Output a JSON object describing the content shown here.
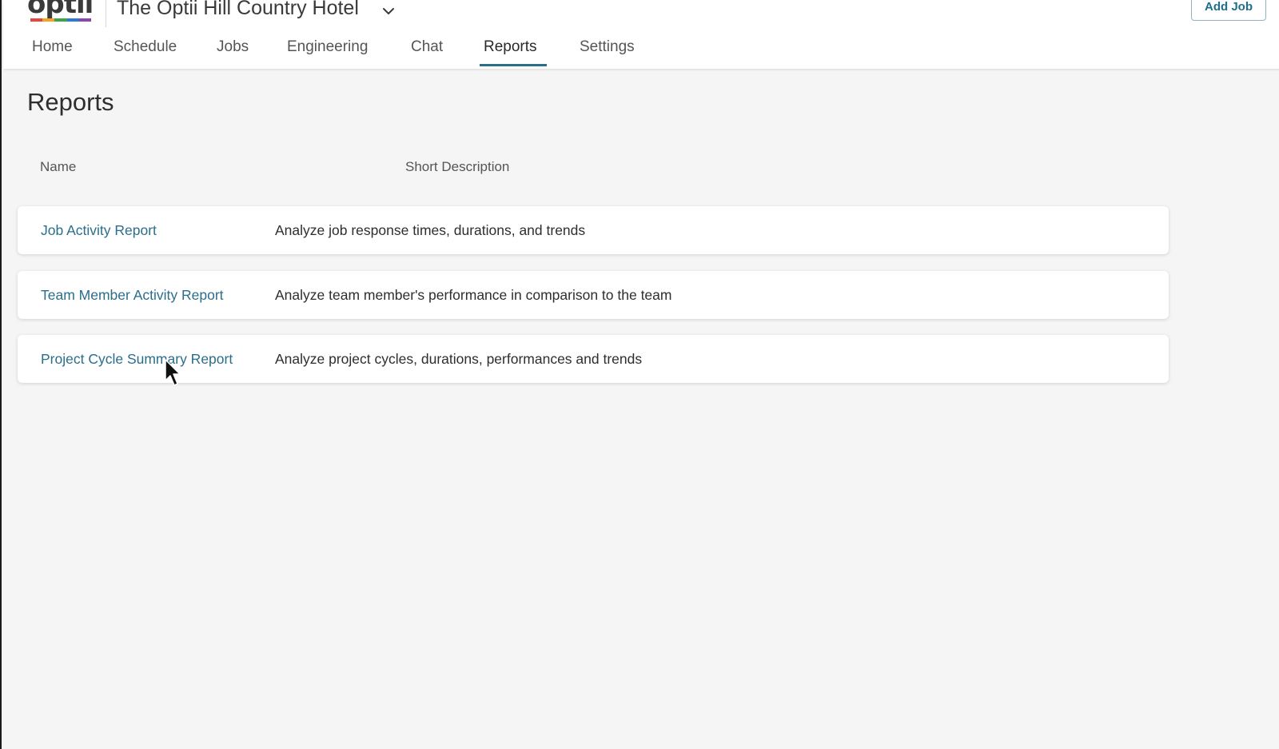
{
  "app": {
    "logo_text": "optii",
    "hotel_title": "The Optii Hill Country Hotel",
    "add_job_label": "Add Job"
  },
  "nav": {
    "tabs": [
      {
        "label": "Home",
        "active": false
      },
      {
        "label": "Schedule",
        "active": false
      },
      {
        "label": "Jobs",
        "active": false
      },
      {
        "label": "Engineering",
        "active": false
      },
      {
        "label": "Chat",
        "active": false
      },
      {
        "label": "Reports",
        "active": true
      },
      {
        "label": "Settings",
        "active": false
      }
    ]
  },
  "page": {
    "title": "Reports",
    "columns": {
      "name": "Name",
      "description": "Short Description"
    },
    "reports": [
      {
        "name": "Job Activity Report",
        "description": "Analyze job response times, durations, and trends"
      },
      {
        "name": "Team Member Activity Report",
        "description": "Analyze team member's performance in comparison to the team"
      },
      {
        "name": "Project Cycle Summary Report",
        "description": "Analyze project cycles, durations, performances and trends"
      }
    ]
  },
  "colors": {
    "accent": "#2b6e8a",
    "logo_bar": [
      "#e8453c",
      "#f4a321",
      "#3fa34d",
      "#2b7bd6",
      "#8e44ad"
    ]
  },
  "icons": {
    "hotel_dropdown": "chevron-down-icon",
    "pointer": "mouse-cursor-icon"
  }
}
